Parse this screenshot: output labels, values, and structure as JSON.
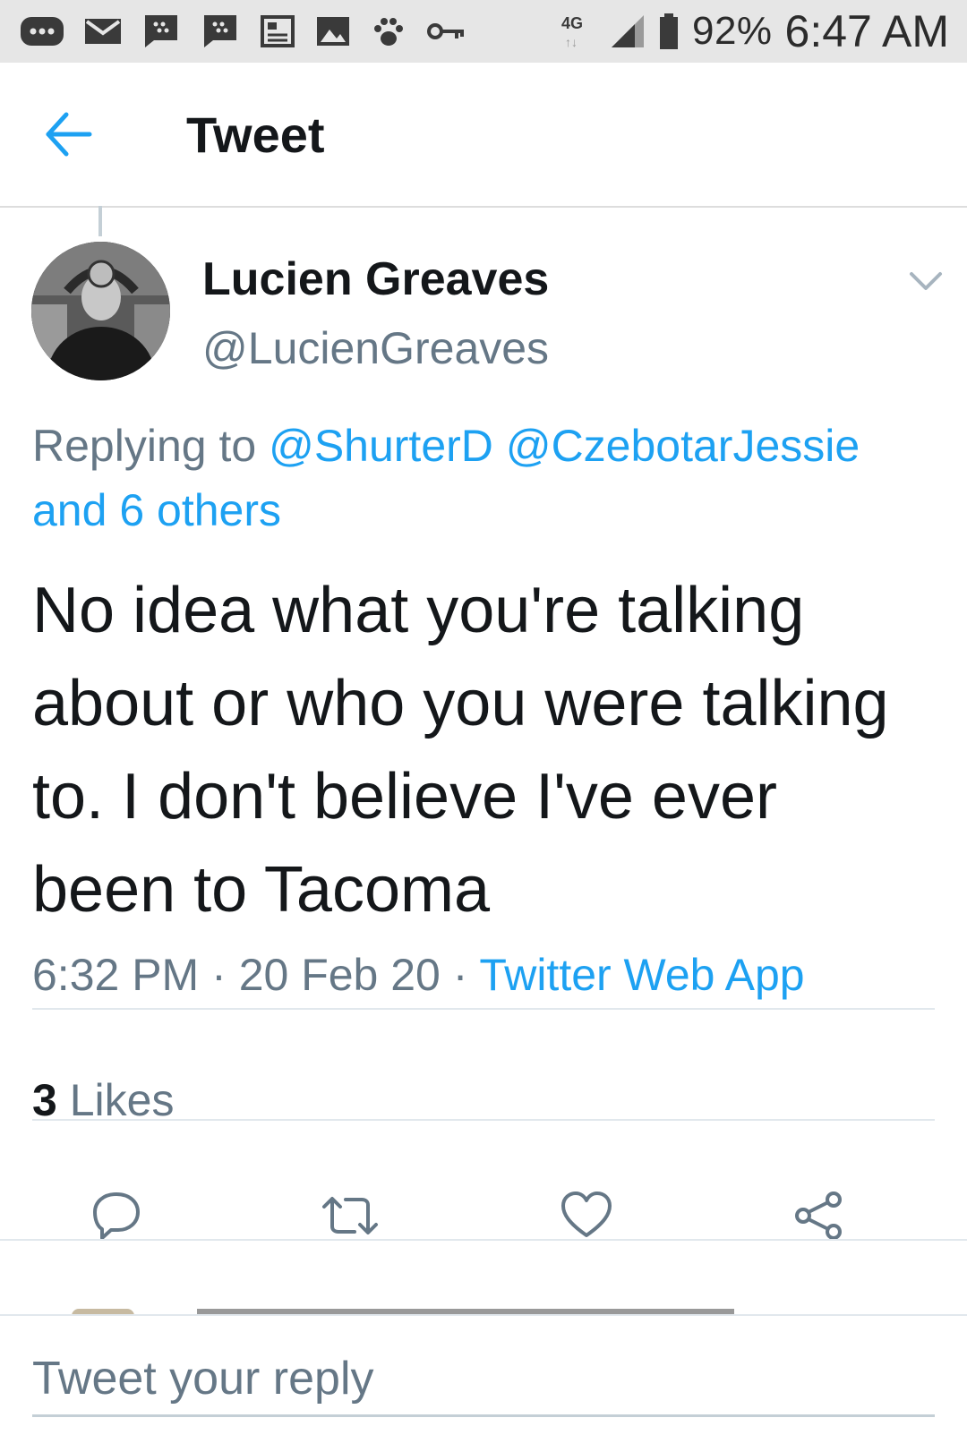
{
  "status_bar": {
    "icons": [
      "more-icon",
      "mail-icon",
      "blackberry-messenger-icon",
      "blackberry-messenger-icon",
      "news-icon",
      "image-icon",
      "paw-icon",
      "key-icon"
    ],
    "network": "4G LTE",
    "battery": "92%",
    "time": "6:47 AM"
  },
  "header": {
    "title": "Tweet",
    "back_icon": "arrow-left-icon"
  },
  "tweet": {
    "author_name": "Lucien Greaves",
    "author_handle": "@LucienGreaves",
    "replying_prefix": "Replying to",
    "reply_targets": [
      "@ShurterD",
      "@CzebotarJessie"
    ],
    "reply_others": "and 6 others",
    "text": "No idea what you're talking about or who you were talking to. I don't believe I've ever been to Tacoma",
    "time": "6:32 PM",
    "date": "20 Feb 20",
    "source": "Twitter Web App",
    "separator": "·",
    "likes_count": "3",
    "likes_label": "Likes"
  },
  "actions": [
    "reply-icon",
    "retweet-icon",
    "like-icon",
    "share-icon"
  ],
  "reply_box": {
    "placeholder": "Tweet your reply"
  },
  "colors": {
    "accent": "#1da1f2",
    "secondary_text": "#657786",
    "primary_text": "#14171a"
  }
}
